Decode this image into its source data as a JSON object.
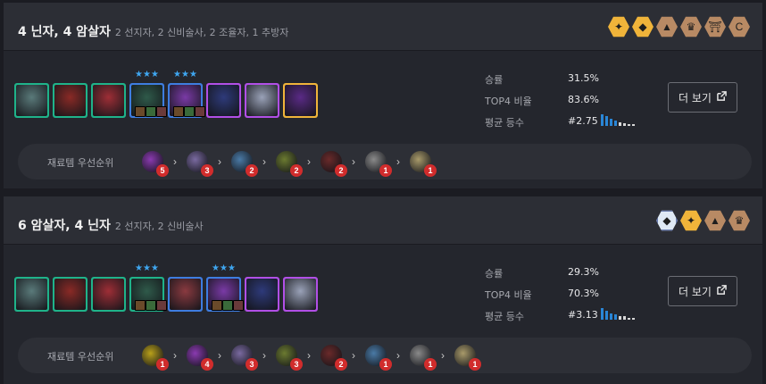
{
  "comps": [
    {
      "title": "4 닌자, 4 암살자",
      "subtitle": "2 선지자, 2 신비술사, 2 조율자, 1 추방자",
      "traits": [
        {
          "icon": "ninja-icon",
          "color": "gold"
        },
        {
          "icon": "assassin-icon",
          "color": "gold"
        },
        {
          "icon": "shade-icon",
          "color": "bronze"
        },
        {
          "icon": "crown-icon",
          "color": "bronze"
        },
        {
          "icon": "shrine-icon",
          "color": "bronze"
        },
        {
          "icon": "hook-icon",
          "color": "bronze"
        }
      ],
      "units": [
        {
          "border": "#1fb38a",
          "face": "#5a7a7a",
          "stars": ""
        },
        {
          "border": "#1fb38a",
          "face": "#8a2a26",
          "stars": ""
        },
        {
          "border": "#1fb38a",
          "face": "#9e2e36",
          "stars": ""
        },
        {
          "border": "#3e7de0",
          "face": "#2f5a4a",
          "stars": "★★★"
        },
        {
          "border": "#3e7de0",
          "face": "#7a3aa6",
          "stars": "★★★"
        },
        {
          "border": "#b14fe6",
          "face": "#2e3a7a",
          "stars": ""
        },
        {
          "border": "#b14fe6",
          "face": "#9aa2b8",
          "stars": ""
        },
        {
          "border": "#f0b43a",
          "face": "#5a2a86",
          "stars": ""
        }
      ],
      "stats": {
        "win_label": "승률",
        "win_value": "31.5%",
        "top4_label": "TOP4 비율",
        "top4_value": "83.6%",
        "avg_label": "평균 등수",
        "avg_value": "#2.75",
        "placement_dist": [
          0.95,
          0.75,
          0.55,
          0.4,
          0.3,
          0.2,
          0.12,
          0.1
        ]
      },
      "more_label": "더 보기",
      "priority_label": "재료템 우선순위",
      "items": [
        {
          "icon": "sword-item-icon",
          "color": "#8a3ab0",
          "count": "5"
        },
        {
          "icon": "belt-item-icon",
          "color": "#7a6aa0",
          "count": "3"
        },
        {
          "icon": "cloak-item-icon",
          "color": "#4a7aa6",
          "count": "2"
        },
        {
          "icon": "bow-item-icon",
          "color": "#6b7a30",
          "count": "2"
        },
        {
          "icon": "glove-item-icon",
          "color": "#6a2a2a",
          "count": "2"
        },
        {
          "icon": "chainvest-item-icon",
          "color": "#8a8a8a",
          "count": "1"
        },
        {
          "icon": "spatula-item-icon",
          "color": "#a89a6a",
          "count": "1"
        }
      ]
    },
    {
      "title": "6 암살자, 4 닌자",
      "subtitle": "2 선지자, 2 신비술사",
      "traits": [
        {
          "icon": "assassin-icon",
          "color": "prism"
        },
        {
          "icon": "ninja-icon",
          "color": "gold"
        },
        {
          "icon": "shade-icon",
          "color": "bronze"
        },
        {
          "icon": "crown-icon",
          "color": "bronze"
        }
      ],
      "units": [
        {
          "border": "#1fb38a",
          "face": "#5a7a7a",
          "stars": ""
        },
        {
          "border": "#1fb38a",
          "face": "#8a2a26",
          "stars": ""
        },
        {
          "border": "#1fb38a",
          "face": "#9e2e36",
          "stars": ""
        },
        {
          "border": "#1fb38a",
          "face": "#2f5a4a",
          "stars": "★★★"
        },
        {
          "border": "#3e7de0",
          "face": "#8a3a40",
          "stars": ""
        },
        {
          "border": "#3e7de0",
          "face": "#7a3aa6",
          "stars": "★★★"
        },
        {
          "border": "#b14fe6",
          "face": "#2e3a7a",
          "stars": ""
        },
        {
          "border": "#b14fe6",
          "face": "#9aa2b8",
          "stars": ""
        }
      ],
      "stats": {
        "win_label": "승률",
        "win_value": "29.3%",
        "top4_label": "TOP4 비율",
        "top4_value": "70.3%",
        "avg_label": "평균 등수",
        "avg_value": "#3.13",
        "placement_dist": [
          0.95,
          0.7,
          0.5,
          0.4,
          0.3,
          0.25,
          0.15,
          0.1
        ]
      },
      "more_label": "더 보기",
      "priority_label": "재료템 우선순위",
      "items": [
        {
          "icon": "bow-item-icon",
          "color": "#b8a01a",
          "count": "1"
        },
        {
          "icon": "sword-item-icon",
          "color": "#8a3ab0",
          "count": "4"
        },
        {
          "icon": "belt-item-icon",
          "color": "#7a6aa0",
          "count": "3"
        },
        {
          "icon": "bow-item-icon",
          "color": "#6b7a30",
          "count": "3"
        },
        {
          "icon": "glove-item-icon",
          "color": "#6a2a2a",
          "count": "2"
        },
        {
          "icon": "cloak-item-icon",
          "color": "#4a7aa6",
          "count": "1"
        },
        {
          "icon": "chainvest-item-icon",
          "color": "#8a8a8a",
          "count": "1"
        },
        {
          "icon": "spatula-item-icon",
          "color": "#a89a6a",
          "count": "1"
        }
      ]
    }
  ],
  "colors": {
    "gold": "#f0b43a",
    "bronze": "#b88a64",
    "prism": "#dfe9f5",
    "bar_active": "#2a86d6",
    "bar_inactive": "#d8d8d8",
    "badge": "#d12c2c"
  }
}
